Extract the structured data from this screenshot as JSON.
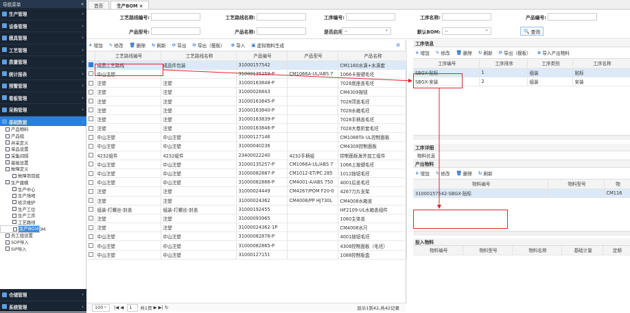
{
  "sidebar": {
    "title": "导航菜单",
    "collapse": "«",
    "items": [
      "生产管理",
      "设备管理",
      "模具管理",
      "工艺管理",
      "质量管理",
      "统计报表",
      "预警管理",
      "看板管理",
      "采购管理",
      "基础数据"
    ],
    "tree": [
      "产品物料",
      "产品组",
      "并采定义",
      "单品设置",
      "采集间隔",
      "基础设置",
      "故障定义",
      "故障项目组",
      "生产建模",
      "生产中心",
      "生产场地",
      "班次维护",
      "生产工位",
      "生产工序",
      "工艺路线",
      "生产BOM",
      "物料生产BOM",
      "员工组设置",
      "SOP导入",
      "SIP导入"
    ],
    "bottom": [
      "仓储管理",
      "系统管理"
    ]
  },
  "tabs": [
    "首页",
    "生产BOM ×"
  ],
  "search": {
    "route_code": "工艺路线编号:",
    "route_name": "工艺路线名称:",
    "proc_code": "工序编号:",
    "proc_name": "工序名称:",
    "prod_code": "产品编号:",
    "prod_model": "产品型号:",
    "prod_name": "产品名称:",
    "enabled": "是否启用:",
    "enabled_val": "--",
    "default_bom": "默认BOM:",
    "default_val": "--",
    "query": "查询"
  },
  "left_toolbar": [
    "增加",
    "修改",
    "删除",
    "刷新",
    "导出",
    "导出（模板）",
    "导入",
    "虚拟物料生成"
  ],
  "left_table": {
    "headers": [
      "工艺路线编号",
      "工艺路线名称",
      "产品编号",
      "产品型号",
      "产品名称"
    ],
    "rows": [
      [
        "成品工艺路线",
        "成品件包装",
        "31000157542",
        "",
        "CM1160水滴+水滴套"
      ],
      [
        "中山注塑",
        "",
        "31000135259-P",
        "CM1066A-UL/ABS 7",
        "1066卡按键毛坯"
      ],
      [
        "注塑",
        "注塑",
        "31000163848-P",
        "",
        "7028底座盖毛坯"
      ],
      [
        "注塑",
        "注塑",
        "31000026843",
        "",
        "CM4309按钮"
      ],
      [
        "注塑",
        "注塑",
        "31000163845-P",
        "",
        "7028顶盖毛坯"
      ],
      [
        "注塑",
        "注塑",
        "31000163840-P",
        "",
        "7028水箱毛坯"
      ],
      [
        "注塑",
        "注塑",
        "31000163839-P",
        "",
        "7028手柄盖毛坯"
      ],
      [
        "注塑",
        "注塑",
        "31000163846-P",
        "",
        "7028大卷折套毛坯"
      ],
      [
        "中山注塑",
        "中山注塑",
        "31000127146",
        "",
        "CM1088TA UL控制面板"
      ],
      [
        "中山注塑",
        "中山注塑",
        "31000040236",
        "",
        "CM4309控制面板"
      ],
      [
        "4232组件",
        "4232组件",
        "23400022240",
        "4232手柄组",
        "控制面板发外加工组件"
      ],
      [
        "中山注塑",
        "中山注塑",
        "31000135257-P",
        "CM1066A-UL/ABS 7",
        "1066上按键毛坯"
      ],
      [
        "中山注塑",
        "中山注塑",
        "31000082887-P",
        "CM1012-ET/PC 285",
        "1012按钮毛坯"
      ],
      [
        "中山注塑",
        "中山注塑",
        "31000082886-P",
        "CM4001-A/ABS 750",
        "4001后盖毛坯"
      ],
      [
        "注塑",
        "注塑",
        "31000024449",
        "CM4267/POM F20-0",
        "4267刀片支架"
      ],
      [
        "注塑",
        "注塑",
        "31000024362",
        "CM4008/PP HJ730L",
        "CM4008水箱盖"
      ],
      [
        "组装-打螺丝-封盖",
        "组装-打螺丝-封盖",
        "31000192455",
        "",
        "HF2109-UL水箱盖组件"
      ],
      [
        "注塑",
        "注塑",
        "31000093965",
        "",
        "1060主体盖"
      ],
      [
        "注塑",
        "注塑",
        "31000024362-1P",
        "",
        "CM4008水尺"
      ],
      [
        "中山注塑",
        "中山注塑",
        "31000082876-P",
        "",
        "4001按钮毛坯"
      ],
      [
        "中山注塑",
        "中山注塑",
        "31000082865-P",
        "",
        "4308控制面板（毛坯）"
      ],
      [
        "中山注塑",
        "中山注塑",
        "31000127151",
        "",
        "1088控制板盒"
      ]
    ]
  },
  "pager": {
    "size": "100",
    "page": "1",
    "of": "共1页",
    "info": "显示1到42,共42记录"
  },
  "proc_panel": {
    "title": "工序信息",
    "toolbar": [
      "增加",
      "修改",
      "删除",
      "刷新",
      "导出（模板）",
      "导入产出物料"
    ],
    "headers": [
      "工序编号",
      "工序排序",
      "工序类别",
      "工序名称"
    ],
    "rows": [
      [
        "SBGX-贴标",
        "1",
        "组装",
        "贴标"
      ],
      [
        "SBGX-安装",
        "2",
        "组装",
        "安装"
      ]
    ]
  },
  "detail": {
    "title": "工序详细",
    "tab": "物料信息",
    "out_title": "产出物料",
    "out_toolbar": [
      "增加",
      "修改",
      "删除",
      "刷新"
    ],
    "out_headers": [
      "物料编号",
      "物料型号",
      "物"
    ],
    "out_rows": [
      [
        "31000157542-SBGX-贴标",
        "",
        "CM116"
      ]
    ],
    "in_title": "投入物料",
    "in_headers": [
      "物料编号",
      "物料型号",
      "物料名称",
      "基础计量",
      "定额"
    ]
  },
  "colors": {
    "accent": "#2c7ed6",
    "annotation": "#e0202a"
  }
}
